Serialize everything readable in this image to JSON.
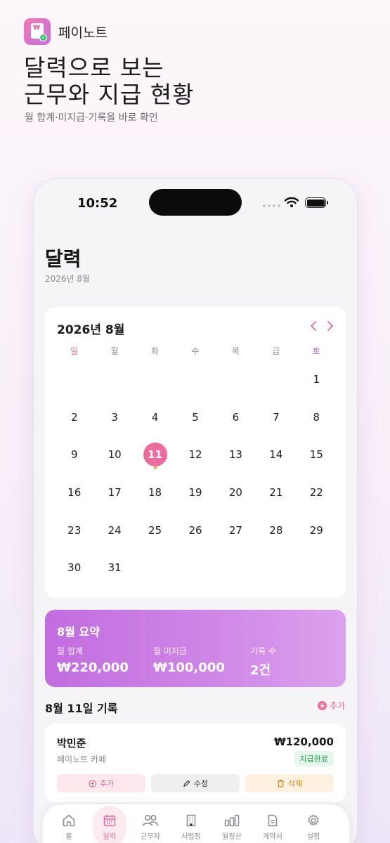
{
  "brand": {
    "name": "페이노트",
    "logo_glyph": "₩"
  },
  "hero": {
    "title_line1": "달력으로 보는",
    "title_line2": "근무와 지급 현황",
    "subtitle": "월 합계·미지급·기록을 바로 확인"
  },
  "status_bar": {
    "time": "10:52"
  },
  "page": {
    "title": "달력",
    "subtitle": "2026년 8월"
  },
  "calendar": {
    "month_label": "2026년 8월",
    "weekdays": [
      "일",
      "월",
      "화",
      "수",
      "목",
      "금",
      "토"
    ],
    "first_weekday_index": 6,
    "days_in_month": 31,
    "today": 11,
    "marked_days": [
      11
    ],
    "accent_color": "#ee6c9d"
  },
  "summary": {
    "title": "8월 요약",
    "total_label": "월 합계",
    "total_value": "₩220,000",
    "unpaid_label": "월 미지급",
    "unpaid_value": "₩100,000",
    "count_label": "기록 수",
    "count_value": "2건"
  },
  "records": {
    "title": "8월 11일 기록",
    "add_label": "추가",
    "items": [
      {
        "name": "박민준",
        "place": "페이노트 카페",
        "amount": "₩120,000",
        "status": "지급완료",
        "actions": {
          "add": "추가",
          "edit": "수정",
          "delete": "삭제"
        }
      }
    ]
  },
  "tabbar": {
    "active": "달력",
    "items": [
      {
        "label": "홈",
        "icon": "home-icon"
      },
      {
        "label": "달력",
        "icon": "calendar-icon"
      },
      {
        "label": "근무자",
        "icon": "people-icon"
      },
      {
        "label": "사업장",
        "icon": "building-icon"
      },
      {
        "label": "월정산",
        "icon": "bar-chart-icon"
      },
      {
        "label": "계약서",
        "icon": "document-icon"
      },
      {
        "label": "설정",
        "icon": "gear-icon"
      }
    ]
  }
}
